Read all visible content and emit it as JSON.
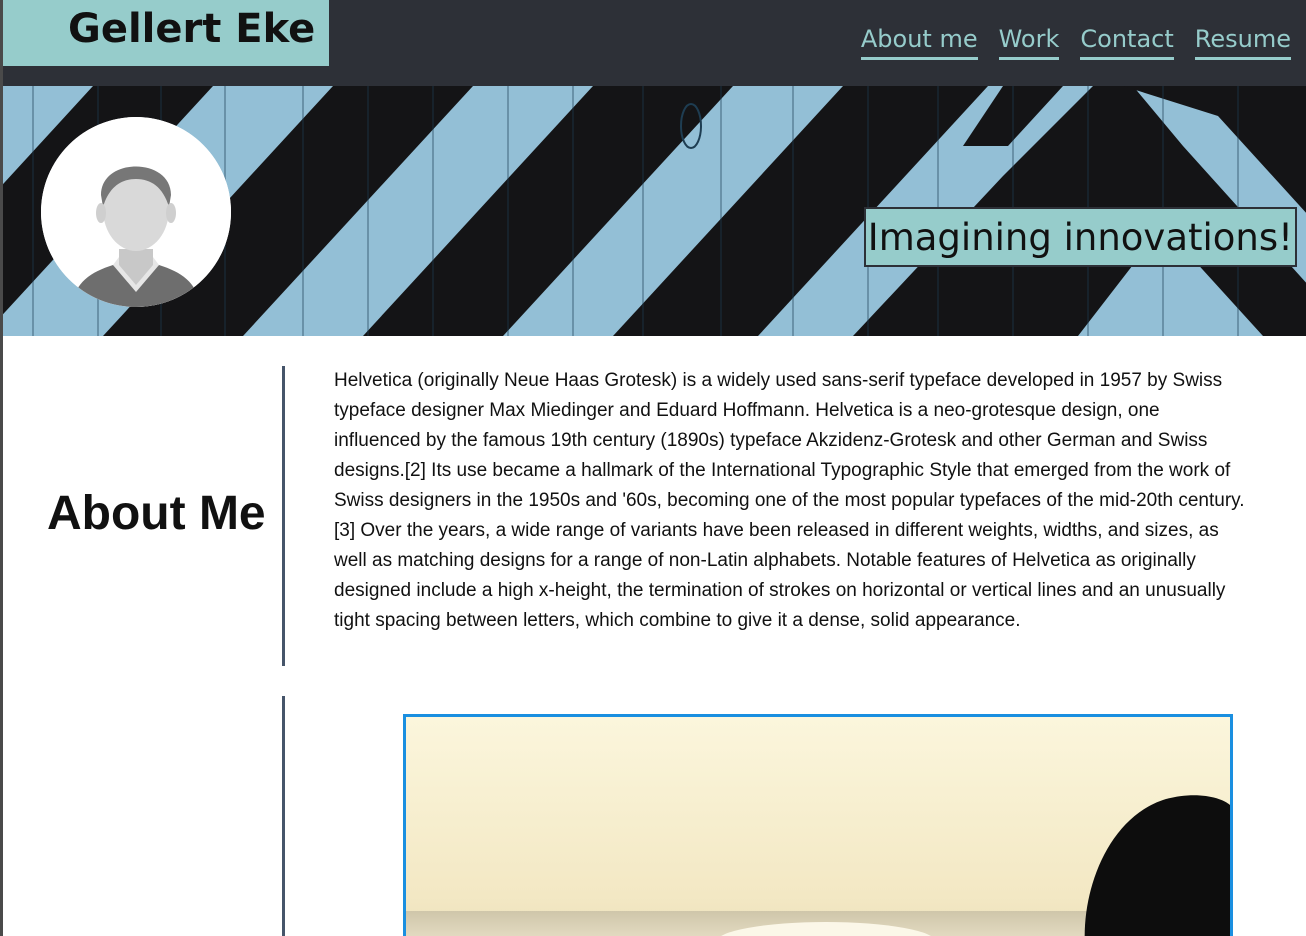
{
  "header": {
    "brand_name": "Gellert Eke",
    "nav": [
      {
        "label": "About me"
      },
      {
        "label": "Work"
      },
      {
        "label": "Contact"
      },
      {
        "label": "Resume"
      }
    ]
  },
  "hero": {
    "tagline": "Imagining innovations!"
  },
  "about": {
    "heading": "About Me",
    "body": "Helvetica (originally Neue Haas Grotesk) is a widely used sans-serif typeface developed in 1957 by Swiss typeface designer Max Miedinger and Eduard Hoffmann. Helvetica is a neo-grotesque design, one influenced by the famous 19th century (1890s) typeface Akzidenz-Grotesk and other German and Swiss designs.[2] Its use became a hallmark of the International Typographic Style that emerged from the work of Swiss designers in the 1950s and '60s, becoming one of the most popular typefaces of the mid-20th century.[3] Over the years, a wide range of variants have been released in different weights, widths, and sizes, as well as matching designs for a range of non-Latin alphabets. Notable features of Helvetica as originally designed include a high x-height, the termination of strokes on horizontal or vertical lines and an unusually tight spacing between letters, which combine to give it a dense, solid appearance."
  },
  "colors": {
    "header_bg": "#2d3037",
    "accent": "#96cccb",
    "divider": "#46556a",
    "work_border": "#1a8fe0"
  },
  "icons": {
    "avatar": "person-silhouette-icon"
  }
}
